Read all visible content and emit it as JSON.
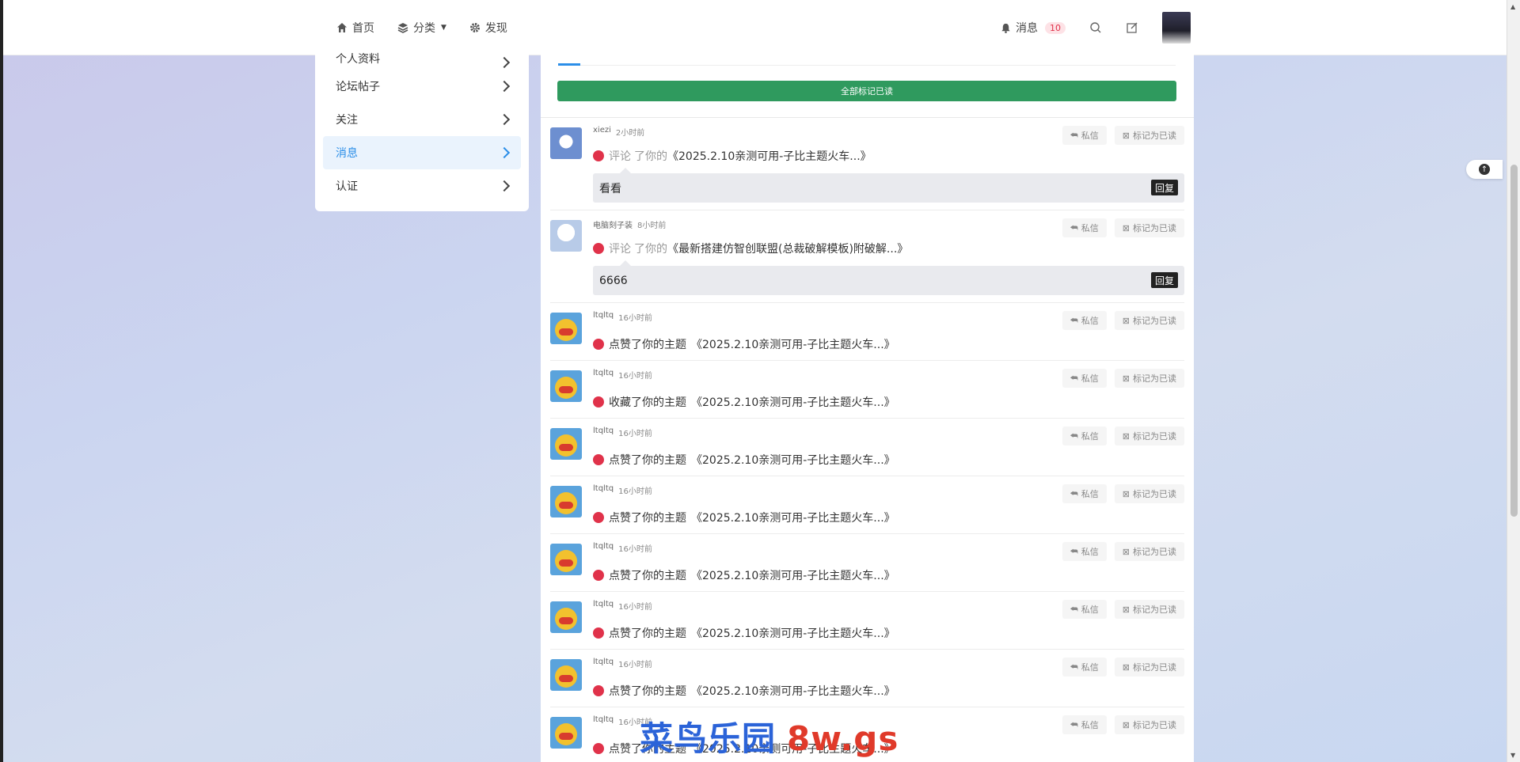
{
  "nav": {
    "home": "首页",
    "category": "分类",
    "discover": "发现",
    "messages": "消息",
    "messages_count": "10"
  },
  "sidebar": {
    "items": [
      {
        "label": "个人资料"
      },
      {
        "label": "论坛帖子"
      },
      {
        "label": "关注"
      },
      {
        "label": "消息"
      },
      {
        "label": "认证"
      }
    ]
  },
  "main": {
    "mark_all_label": "全部标记已读",
    "action_message": "私信",
    "action_mark_read": "标记为已读",
    "reply_label": "回复"
  },
  "notifications": [
    {
      "user": "xiezi",
      "time": "2小时前",
      "verb": "评论",
      "verb_suffix": "了你的",
      "post": "《2025.2.10亲测可用-子比主题火车...》",
      "reply": "看看"
    },
    {
      "user": "电脑刻子装",
      "time": "8小时前",
      "verb": "评论",
      "verb_suffix": "了你的",
      "post": "《最新搭建仿智创联盟(总裁破解模板)附破解...》",
      "reply": "6666"
    },
    {
      "user": "ltqltq",
      "time": "16小时前",
      "text": "点赞了你的主题",
      "post": "《2025.2.10亲测可用-子比主题火车...》"
    },
    {
      "user": "ltqltq",
      "time": "16小时前",
      "text": "收藏了你的主题",
      "post": "《2025.2.10亲测可用-子比主题火车...》"
    },
    {
      "user": "ltqltq",
      "time": "16小时前",
      "text": "点赞了你的主题",
      "post": "《2025.2.10亲测可用-子比主题火车...》"
    },
    {
      "user": "ltqltq",
      "time": "16小时前",
      "text": "点赞了你的主题",
      "post": "《2025.2.10亲测可用-子比主题火车...》"
    },
    {
      "user": "ltqltq",
      "time": "16小时前",
      "text": "点赞了你的主题",
      "post": "《2025.2.10亲测可用-子比主题火车...》"
    },
    {
      "user": "ltqltq",
      "time": "16小时前",
      "text": "点赞了你的主题",
      "post": "《2025.2.10亲测可用-子比主题火车...》"
    },
    {
      "user": "ltqltq",
      "time": "16小时前",
      "text": "点赞了你的主题",
      "post": "《2025.2.10亲测可用-子比主题火车...》"
    },
    {
      "user": "ltqltq",
      "time": "16小时前",
      "text": "点赞了你的主题",
      "post": "《2025.2.10亲测可用-子比主题火车...》"
    }
  ],
  "watermark": {
    "left": "菜鸟乐园",
    "right": "8w.gs"
  },
  "colors": {
    "accent": "#2b8ee8",
    "mark_all_bg": "#2f9a5e",
    "unread_dot": "#e0324a"
  }
}
